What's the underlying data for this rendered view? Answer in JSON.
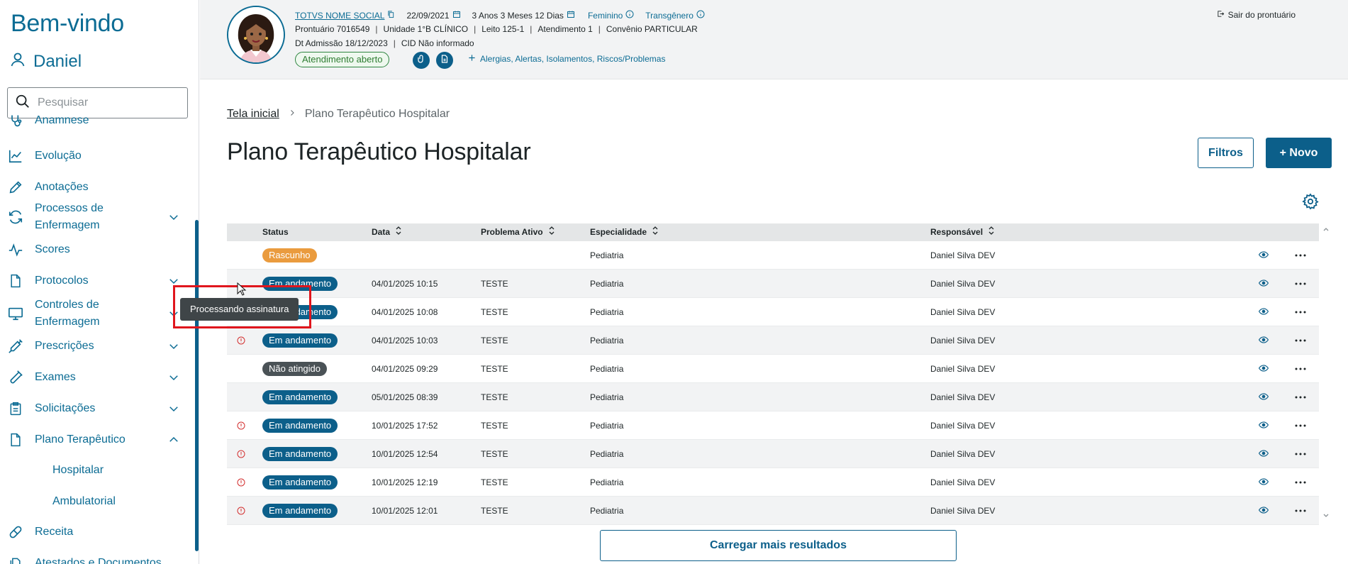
{
  "sidebar": {
    "welcome": "Bem-vindo",
    "user_name": "Daniel",
    "search_placeholder": "Pesquisar",
    "items": [
      {
        "label": "Anamnese"
      },
      {
        "label": "Evolução"
      },
      {
        "label": "Anotações"
      },
      {
        "label": "Processos de Enfermagem"
      },
      {
        "label": "Scores"
      },
      {
        "label": "Protocolos"
      },
      {
        "label": "Controles de Enfermagem"
      },
      {
        "label": "Prescrições"
      },
      {
        "label": "Exames"
      },
      {
        "label": "Solicitações"
      },
      {
        "label": "Plano Terapêutico"
      },
      {
        "label": "Receita"
      },
      {
        "label": "Atestados e Documentos"
      }
    ],
    "subitems": [
      {
        "label": "Hospitalar"
      },
      {
        "label": "Ambulatorial"
      }
    ]
  },
  "patient": {
    "social_name": "TOTVS NOME SOCIAL",
    "birth_date": "22/09/2021",
    "age": "3 Anos 3 Meses 12 Dias",
    "gender": "Feminino",
    "identity": "Transgênero",
    "prontuario": "Prontuário 7016549",
    "unidade": "Unidade 1°B CLÍNICO",
    "leito": "Leito 125-1",
    "atendimento": "Atendimento 1",
    "convenio": "Convênio PARTICULAR",
    "admissao": "Dt Admissão 18/12/2023",
    "cid": "CID Não informado",
    "status_badge": "Atendimento aberto",
    "alerts_link": "Alergias, Alertas, Isolamentos, Riscos/Problemas",
    "logout": "Sair do prontuário"
  },
  "breadcrumb": {
    "home": "Tela inicial",
    "current": "Plano Terapêutico Hospitalar"
  },
  "page": {
    "title": "Plano Terapêutico Hospitalar",
    "filters_label": "Filtros",
    "new_label": "+ Novo",
    "load_more": "Carregar mais resultados"
  },
  "table": {
    "headers": {
      "status": "Status",
      "data": "Data",
      "problema": "Problema Ativo",
      "especialidade": "Especialidade",
      "responsavel": "Responsável"
    },
    "rows": [
      {
        "status": "Rascunho",
        "kind": "rascunho",
        "warn": false,
        "data": "",
        "problema": "",
        "especialidade": "Pediatria",
        "responsavel": "Daniel Silva DEV"
      },
      {
        "status": "Em andamento",
        "kind": "andamento",
        "warn": false,
        "data": "04/01/2025 10:15",
        "problema": "TESTE",
        "especialidade": "Pediatria",
        "responsavel": "Daniel Silva DEV"
      },
      {
        "status": "Em andamento",
        "kind": "andamento",
        "warn": false,
        "data": "04/01/2025 10:08",
        "problema": "TESTE",
        "especialidade": "Pediatria",
        "responsavel": "Daniel Silva DEV"
      },
      {
        "status": "Em andamento",
        "kind": "andamento",
        "warn": true,
        "data": "04/01/2025 10:03",
        "problema": "TESTE",
        "especialidade": "Pediatria",
        "responsavel": "Daniel Silva DEV"
      },
      {
        "status": "Não atingido",
        "kind": "nao",
        "warn": false,
        "data": "04/01/2025 09:29",
        "problema": "TESTE",
        "especialidade": "Pediatria",
        "responsavel": "Daniel Silva DEV"
      },
      {
        "status": "Em andamento",
        "kind": "andamento",
        "warn": false,
        "data": "05/01/2025 08:39",
        "problema": "TESTE",
        "especialidade": "Pediatria",
        "responsavel": "Daniel Silva DEV"
      },
      {
        "status": "Em andamento",
        "kind": "andamento",
        "warn": true,
        "data": "10/01/2025 17:52",
        "problema": "TESTE",
        "especialidade": "Pediatria",
        "responsavel": "Daniel Silva DEV"
      },
      {
        "status": "Em andamento",
        "kind": "andamento",
        "warn": true,
        "data": "10/01/2025 12:54",
        "problema": "TESTE",
        "especialidade": "Pediatria",
        "responsavel": "Daniel Silva DEV"
      },
      {
        "status": "Em andamento",
        "kind": "andamento",
        "warn": true,
        "data": "10/01/2025 12:19",
        "problema": "TESTE",
        "especialidade": "Pediatria",
        "responsavel": "Daniel Silva DEV"
      },
      {
        "status": "Em andamento",
        "kind": "andamento",
        "warn": true,
        "data": "10/01/2025 12:01",
        "problema": "TESTE",
        "especialidade": "Pediatria",
        "responsavel": "Daniel Silva DEV"
      }
    ]
  },
  "tooltip": {
    "text": "Processando assinatura"
  },
  "colors": {
    "brand": "#0c6c94",
    "primary_button": "#0c5f8a",
    "rascunho": "#ea9b3e",
    "nao_atingido": "#4a5256",
    "warning": "#d32f2f",
    "open_badge": "#2e8540"
  }
}
